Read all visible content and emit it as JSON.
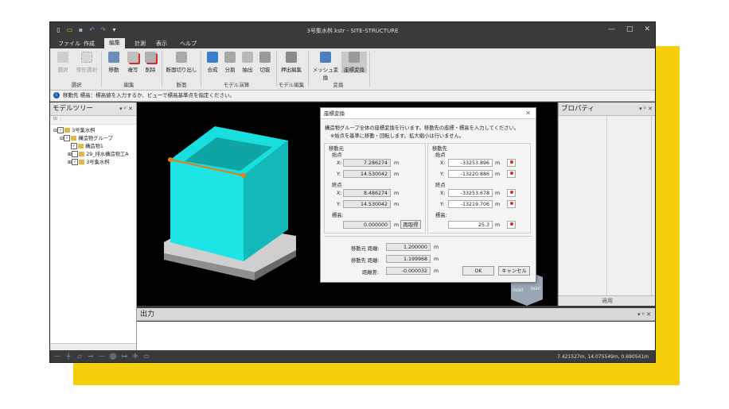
{
  "title": "3号集水桝.kstr - SITE-STRUCTURE",
  "window_controls": {
    "minimize": "—",
    "restore": "□",
    "close": "✕"
  },
  "quick_access": {
    "new": "▯",
    "open": "▭",
    "save": "▪",
    "undo": "↶",
    "redo": "↷",
    "more": "▾"
  },
  "menu": {
    "file": "ファイル",
    "create": "作成",
    "edit": "編集",
    "measure": "計測",
    "view": "表示",
    "help": "ヘルプ"
  },
  "ribbon": {
    "select": "選択",
    "rect_select": "矩形選択",
    "group_select": "選択",
    "move": "移動",
    "copy": "複写",
    "delete": "削除",
    "group_edit": "編集",
    "section_cut": "断面切り出し",
    "group_section": "断面",
    "combine": "合成",
    "split": "分割",
    "extract": "抽出",
    "cut": "切抜",
    "group_model_calc": "モデル演算",
    "extrude_edit": "押出編集",
    "group_model_edit": "モデル編集",
    "mesh_convert": "メッシュ変換",
    "coord_convert": "座標変換",
    "group_convert": "変換"
  },
  "info_message": "移動先 標高：標高値を入力するか、ビューで標高基準点を指定ください。",
  "left_panel": {
    "title": "モデルツリー",
    "tree": [
      "3号集水桝",
      "構造物グループ",
      "構造物1",
      "29_排水構造物工A",
      "3号集水桝"
    ]
  },
  "right_panel": {
    "title": "プロパティ",
    "apply": "適用"
  },
  "output_panel": {
    "title": "出力"
  },
  "status": {
    "coords": "7.421527m, 14.075549m, 0.690541m"
  },
  "viewcube": {
    "front": "FRONT",
    "right": "RIGHT"
  },
  "dialog": {
    "title": "座標変換",
    "desc1": "構造物グループ全体の座標変換を行います。移動先の座標・標高を入力してください。",
    "desc2": "※始点を基準に移動・回転します。拡大縮小は行いません。",
    "src_label": "移動元",
    "dst_label": "移動先",
    "start": "始点",
    "end": "終点",
    "x": "X:",
    "y": "Y:",
    "elev": "標高:",
    "unit_m": "m",
    "src_start_x": "7.286274",
    "src_start_y": "14.530042",
    "src_end_x": "8.486274",
    "src_end_y": "14.530042",
    "src_elev": "0.000000",
    "reget": "再取得",
    "dst_start_x": "-33253.896",
    "dst_start_y": "-13220.886",
    "dst_end_x": "-33253.678",
    "dst_end_y": "-13219.706",
    "dst_elev": "25.3",
    "src_dist_label": "移動元 距離:",
    "src_dist": "1.200000",
    "dst_dist_label": "移動先 距離:",
    "dst_dist": "1.199968",
    "diff_label": "距離差:",
    "diff": "-0.000032",
    "ok": "OK",
    "cancel": "キャンセル"
  },
  "colors": {
    "accent": "#1a5fb4",
    "model": "#1ee5e5",
    "highlight": "#f07a10",
    "backdrop": "#f5cf0a"
  }
}
